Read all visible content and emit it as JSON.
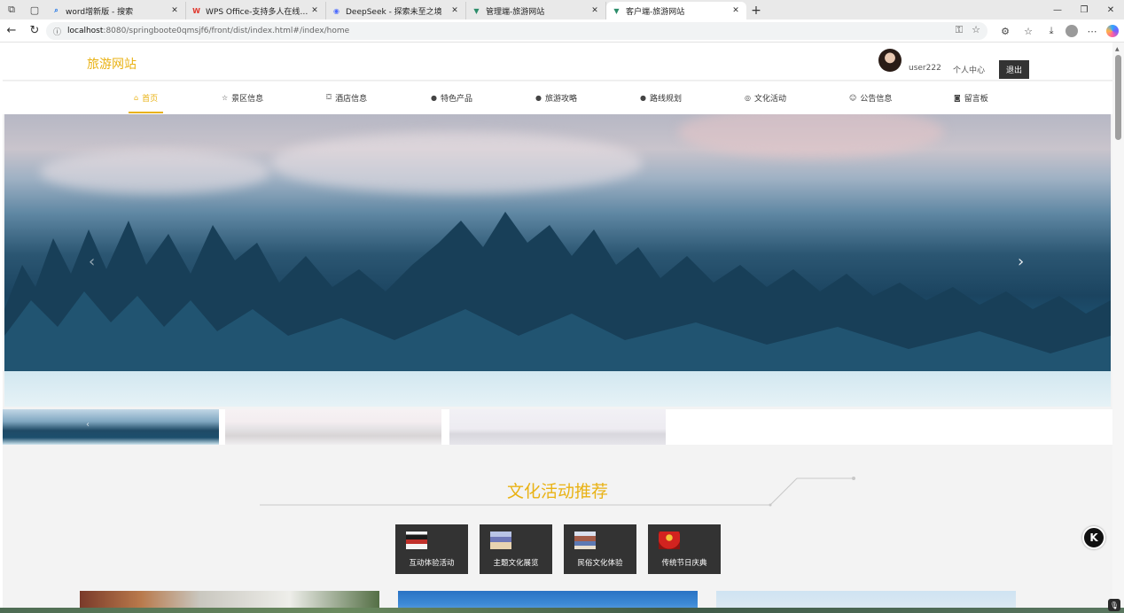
{
  "browser": {
    "tabs": [
      {
        "title": "word增新版 - 搜索",
        "icon": "search-icon",
        "color": "#1a73e8"
      },
      {
        "title": "WPS Office-支持多人在线编辑多种文档格式",
        "icon": "wps-icon",
        "color": "#e0362c"
      },
      {
        "title": "DeepSeek - 探索未至之境",
        "icon": "deepseek-icon",
        "color": "#4d6bfe"
      },
      {
        "title": "管理端-旅游网站",
        "icon": "vue-icon",
        "color": "#2c8d6a"
      },
      {
        "title": "客户端-旅游网站",
        "icon": "vue-icon",
        "color": "#2c8d6a",
        "active": true
      }
    ],
    "url_host": "localhost",
    "url_rest": ":8080/springboote0qmsjf6/front/dist/index.html#/index/home"
  },
  "site": {
    "logo": "旅游网站",
    "username": "user222",
    "user_center": "个人中心",
    "logout": "退出",
    "accent": "#e9b214"
  },
  "nav": [
    {
      "label": "首页",
      "icon": "home-icon",
      "active": true
    },
    {
      "label": "景区信息",
      "icon": "star-icon"
    },
    {
      "label": "酒店信息",
      "icon": "shopping-bag-icon"
    },
    {
      "label": "特色产品",
      "icon": "info-circle-icon"
    },
    {
      "label": "旅游攻略",
      "icon": "question-circle-icon"
    },
    {
      "label": "路线规划",
      "icon": "info-circle-icon"
    },
    {
      "label": "文化活动",
      "icon": "globe-icon"
    },
    {
      "label": "公告信息",
      "icon": "smile-icon"
    },
    {
      "label": "留言板",
      "icon": "camera-icon"
    }
  ],
  "culture": {
    "title": "文化活动推荐",
    "categories": [
      {
        "label": "互动体验活动",
        "icon": "theater-image"
      },
      {
        "label": "主题文化展览",
        "icon": "exhibition-image"
      },
      {
        "label": "民俗文化体验",
        "icon": "folk-image"
      },
      {
        "label": "传统节日庆典",
        "icon": "festival-image"
      }
    ]
  }
}
